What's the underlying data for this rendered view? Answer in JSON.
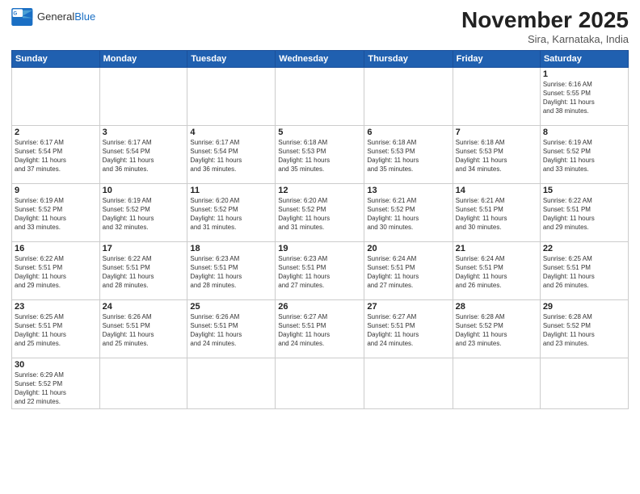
{
  "logo": {
    "text_general": "General",
    "text_blue": "Blue"
  },
  "header": {
    "month_title": "November 2025",
    "subtitle": "Sira, Karnataka, India"
  },
  "days_of_week": [
    "Sunday",
    "Monday",
    "Tuesday",
    "Wednesday",
    "Thursday",
    "Friday",
    "Saturday"
  ],
  "weeks": [
    [
      {
        "day": "",
        "info": ""
      },
      {
        "day": "",
        "info": ""
      },
      {
        "day": "",
        "info": ""
      },
      {
        "day": "",
        "info": ""
      },
      {
        "day": "",
        "info": ""
      },
      {
        "day": "",
        "info": ""
      },
      {
        "day": "1",
        "info": "Sunrise: 6:16 AM\nSunset: 5:55 PM\nDaylight: 11 hours\nand 38 minutes."
      }
    ],
    [
      {
        "day": "2",
        "info": "Sunrise: 6:17 AM\nSunset: 5:54 PM\nDaylight: 11 hours\nand 37 minutes."
      },
      {
        "day": "3",
        "info": "Sunrise: 6:17 AM\nSunset: 5:54 PM\nDaylight: 11 hours\nand 36 minutes."
      },
      {
        "day": "4",
        "info": "Sunrise: 6:17 AM\nSunset: 5:54 PM\nDaylight: 11 hours\nand 36 minutes."
      },
      {
        "day": "5",
        "info": "Sunrise: 6:18 AM\nSunset: 5:53 PM\nDaylight: 11 hours\nand 35 minutes."
      },
      {
        "day": "6",
        "info": "Sunrise: 6:18 AM\nSunset: 5:53 PM\nDaylight: 11 hours\nand 35 minutes."
      },
      {
        "day": "7",
        "info": "Sunrise: 6:18 AM\nSunset: 5:53 PM\nDaylight: 11 hours\nand 34 minutes."
      },
      {
        "day": "8",
        "info": "Sunrise: 6:19 AM\nSunset: 5:52 PM\nDaylight: 11 hours\nand 33 minutes."
      }
    ],
    [
      {
        "day": "9",
        "info": "Sunrise: 6:19 AM\nSunset: 5:52 PM\nDaylight: 11 hours\nand 33 minutes."
      },
      {
        "day": "10",
        "info": "Sunrise: 6:19 AM\nSunset: 5:52 PM\nDaylight: 11 hours\nand 32 minutes."
      },
      {
        "day": "11",
        "info": "Sunrise: 6:20 AM\nSunset: 5:52 PM\nDaylight: 11 hours\nand 31 minutes."
      },
      {
        "day": "12",
        "info": "Sunrise: 6:20 AM\nSunset: 5:52 PM\nDaylight: 11 hours\nand 31 minutes."
      },
      {
        "day": "13",
        "info": "Sunrise: 6:21 AM\nSunset: 5:52 PM\nDaylight: 11 hours\nand 30 minutes."
      },
      {
        "day": "14",
        "info": "Sunrise: 6:21 AM\nSunset: 5:51 PM\nDaylight: 11 hours\nand 30 minutes."
      },
      {
        "day": "15",
        "info": "Sunrise: 6:22 AM\nSunset: 5:51 PM\nDaylight: 11 hours\nand 29 minutes."
      }
    ],
    [
      {
        "day": "16",
        "info": "Sunrise: 6:22 AM\nSunset: 5:51 PM\nDaylight: 11 hours\nand 29 minutes."
      },
      {
        "day": "17",
        "info": "Sunrise: 6:22 AM\nSunset: 5:51 PM\nDaylight: 11 hours\nand 28 minutes."
      },
      {
        "day": "18",
        "info": "Sunrise: 6:23 AM\nSunset: 5:51 PM\nDaylight: 11 hours\nand 28 minutes."
      },
      {
        "day": "19",
        "info": "Sunrise: 6:23 AM\nSunset: 5:51 PM\nDaylight: 11 hours\nand 27 minutes."
      },
      {
        "day": "20",
        "info": "Sunrise: 6:24 AM\nSunset: 5:51 PM\nDaylight: 11 hours\nand 27 minutes."
      },
      {
        "day": "21",
        "info": "Sunrise: 6:24 AM\nSunset: 5:51 PM\nDaylight: 11 hours\nand 26 minutes."
      },
      {
        "day": "22",
        "info": "Sunrise: 6:25 AM\nSunset: 5:51 PM\nDaylight: 11 hours\nand 26 minutes."
      }
    ],
    [
      {
        "day": "23",
        "info": "Sunrise: 6:25 AM\nSunset: 5:51 PM\nDaylight: 11 hours\nand 25 minutes."
      },
      {
        "day": "24",
        "info": "Sunrise: 6:26 AM\nSunset: 5:51 PM\nDaylight: 11 hours\nand 25 minutes."
      },
      {
        "day": "25",
        "info": "Sunrise: 6:26 AM\nSunset: 5:51 PM\nDaylight: 11 hours\nand 24 minutes."
      },
      {
        "day": "26",
        "info": "Sunrise: 6:27 AM\nSunset: 5:51 PM\nDaylight: 11 hours\nand 24 minutes."
      },
      {
        "day": "27",
        "info": "Sunrise: 6:27 AM\nSunset: 5:51 PM\nDaylight: 11 hours\nand 24 minutes."
      },
      {
        "day": "28",
        "info": "Sunrise: 6:28 AM\nSunset: 5:52 PM\nDaylight: 11 hours\nand 23 minutes."
      },
      {
        "day": "29",
        "info": "Sunrise: 6:28 AM\nSunset: 5:52 PM\nDaylight: 11 hours\nand 23 minutes."
      }
    ],
    [
      {
        "day": "30",
        "info": "Sunrise: 6:29 AM\nSunset: 5:52 PM\nDaylight: 11 hours\nand 22 minutes."
      },
      {
        "day": "",
        "info": ""
      },
      {
        "day": "",
        "info": ""
      },
      {
        "day": "",
        "info": ""
      },
      {
        "day": "",
        "info": ""
      },
      {
        "day": "",
        "info": ""
      },
      {
        "day": "",
        "info": ""
      }
    ]
  ]
}
